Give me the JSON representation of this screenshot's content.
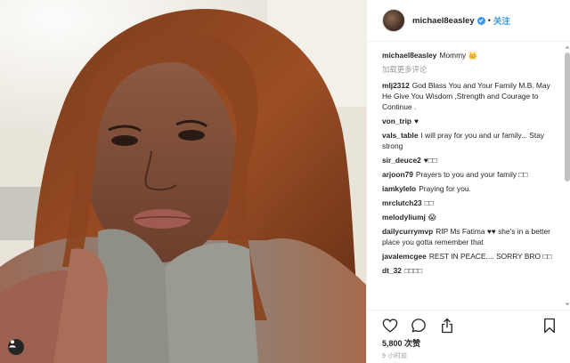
{
  "post": {
    "username": "michael8easley",
    "follow_label": "关注",
    "separator": "•"
  },
  "caption": {
    "username": "michael8easley",
    "text": "Mommy 👑"
  },
  "load_more_label": "加载更多评论",
  "comments": [
    {
      "user": "mlj2312",
      "text": "God Blass You and Your Family M.B. May He Give You Wisdom ,Strength and Courage to Continue ."
    },
    {
      "user": "von_trip",
      "text": "♥"
    },
    {
      "user": "vals_table",
      "text": "I will pray for you and ur family... Stay strong"
    },
    {
      "user": "sir_deuce2",
      "text": "♥□□"
    },
    {
      "user": "arjoon79",
      "text": "Prayers to you and your family □□"
    },
    {
      "user": "iamkylelo",
      "text": "Praying for you."
    },
    {
      "user": "mrclutch23",
      "text": "□□"
    },
    {
      "user": "melodyliumj",
      "text": "😱"
    },
    {
      "user": "dailycurrymvp",
      "text": "RIP Ms Fatima ♥♥ she's in a better place you gotta remember that"
    },
    {
      "user": "javalemcgee",
      "text": "REST IN PEACE.... SORRY BRO □□"
    },
    {
      "user": "dt_32",
      "text": "□□□□"
    }
  ],
  "likes": "5,800 次赞",
  "timestamp": "9 小时前",
  "colors": {
    "link_blue": "#3897f0",
    "text": "#262626",
    "muted": "#999999",
    "border": "#efefef"
  },
  "icons": [
    "heart-icon",
    "comment-icon",
    "share-icon",
    "bookmark-icon",
    "verified-icon",
    "user-tag-icon"
  ]
}
